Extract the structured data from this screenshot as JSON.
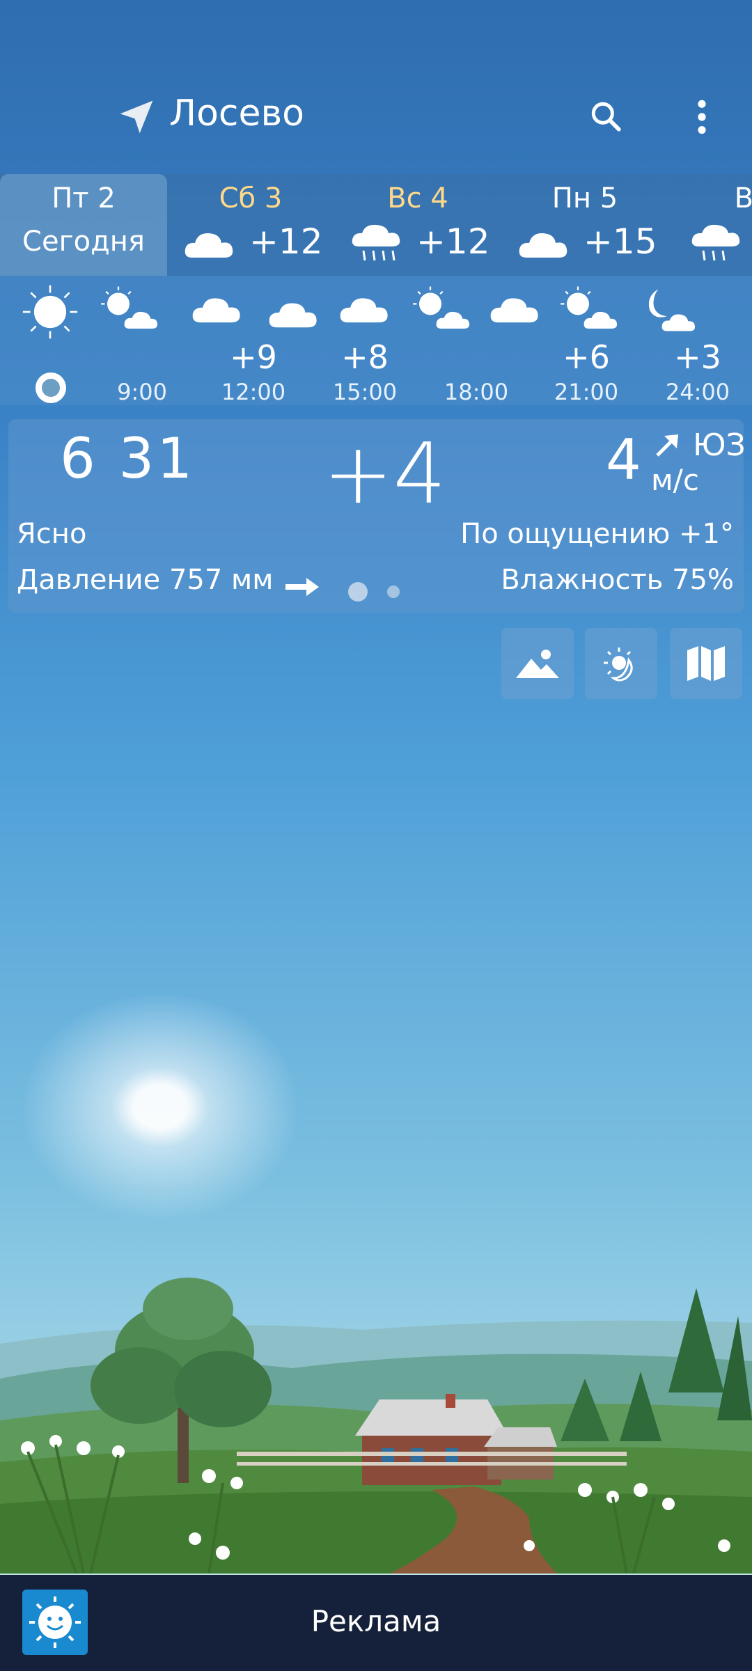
{
  "header": {
    "city": "Лосево"
  },
  "days": [
    {
      "label": "Пт 2",
      "sub": "Сегодня",
      "temp": "",
      "active": true
    },
    {
      "label": "Сб 3",
      "sub": "",
      "temp": "+12"
    },
    {
      "label": "Вс 4",
      "sub": "",
      "temp": "+12"
    },
    {
      "label": "Пн 5",
      "sub": "",
      "temp": "+15"
    },
    {
      "label": "Вт",
      "sub": "",
      "temp": ""
    }
  ],
  "hourly": [
    {
      "time": "9:00",
      "temp": ""
    },
    {
      "time": "12:00",
      "temp": "+9"
    },
    {
      "time": "15:00",
      "temp": "+8"
    },
    {
      "time": "18:00",
      "temp": ""
    },
    {
      "time": "21:00",
      "temp": "+6"
    },
    {
      "time": "24:00",
      "temp": "+3"
    }
  ],
  "current": {
    "time": "6 31",
    "temp": "+4",
    "wind_speed": "4",
    "wind_unit": "м/с",
    "wind_dir": "ЮЗ",
    "condition": "Ясно",
    "feels_like": "По ощущению +1°",
    "pressure": "Давление 757 мм",
    "humidity": "Влажность 75%"
  },
  "ad": {
    "label": "Реклама"
  },
  "colors": {
    "sat_label": "#ffd88a",
    "ad_bar": "#15213a",
    "ad_logo": "#1a8ad0"
  }
}
